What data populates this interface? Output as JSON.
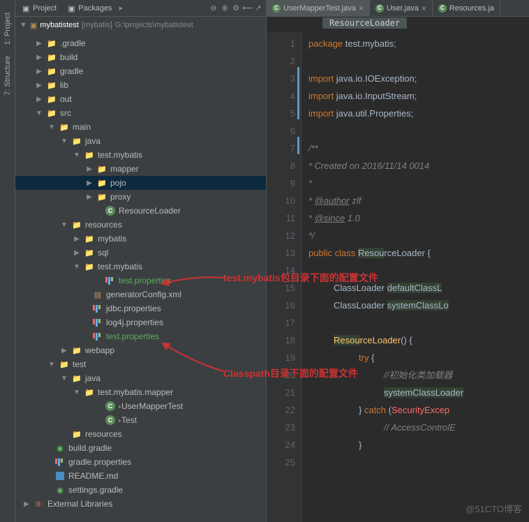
{
  "leftTabs": {
    "project": "1: Project",
    "structure": "7: Structure"
  },
  "panel": {
    "tabProject": "Project",
    "tabPackages": "Packages"
  },
  "breadcrumb": {
    "module": "mybatistest",
    "bracket": "[mybatis]",
    "path": "G:\\projects\\mybatistest"
  },
  "tree": {
    "gradleDir": ".gradle",
    "build": "build",
    "gradle": "gradle",
    "lib": "lib",
    "out": "out",
    "src": "src",
    "main": "main",
    "java": "java",
    "testMybatis": "test.mybatis",
    "mapper": "mapper",
    "pojo": "pojo",
    "proxy": "proxy",
    "resourceLoader": "ResourceLoader",
    "resources": "resources",
    "mybatis": "mybatis",
    "sql": "sql",
    "testProps1": "test.properties",
    "generatorConfig": "generatorConfig.xml",
    "jdbcProps": "jdbc.properties",
    "log4jProps": "log4j.properties",
    "testProps2": "test.properties",
    "webapp": "webapp",
    "test": "test",
    "testMybatisMapper": "test.mybatis.mapper",
    "userMapperTest": "UserMapperTest",
    "testClass": "Test",
    "buildGradle": "build.gradle",
    "gradleProps": "gradle.properties",
    "readme": "README.md",
    "settingsGradle": "settings.gradle",
    "extLibs": "External Libraries"
  },
  "editorTabs": {
    "t1": "UserMapperTest.java",
    "t2": "User.java",
    "t3": "Resources.ja"
  },
  "codeBreadcrumb": "ResourceLoader",
  "code": {
    "l1a": "package",
    "l1b": " test.mybatis;",
    "l3a": "import",
    "l3b": " java.io.IOException;",
    "l4a": "import",
    "l4b": " java.io.InputStream;",
    "l5a": "import",
    "l5b": " java.util.Properties;",
    "l7": "/**",
    "l8": " * Created on 2016/11/14 0014",
    "l9": " *",
    "l10a": " * ",
    "l10b": "@author",
    "l10c": " zlf",
    "l11a": " * ",
    "l11b": "@since",
    "l11c": " 1.0",
    "l12": " */",
    "l13a": "public class ",
    "l13b": "Resou",
    "l13c": "rceLoader {",
    "l15a": "ClassLoader ",
    "l15b": "defaultClassL",
    "l16a": "ClassLoader ",
    "l16b": "systemClassLo",
    "l18a": "Resou",
    "l18b": "rceLoader",
    "l18c": "() {",
    "l19a": "try",
    "l19b": " {",
    "l20": "//初始化类加载器",
    "l21": "systemClassLoader",
    "l22a": "} ",
    "l22b": "catch",
    "l22c": " (",
    "l22d": "SecurityExcep",
    "l23": "// AccessControlE",
    "l24": "}"
  },
  "annotations": {
    "a1": "test.mybatis包目录下面的配置文件",
    "a2": "Classpath目录下面的配置文件"
  },
  "watermark": "@51CTO博客"
}
